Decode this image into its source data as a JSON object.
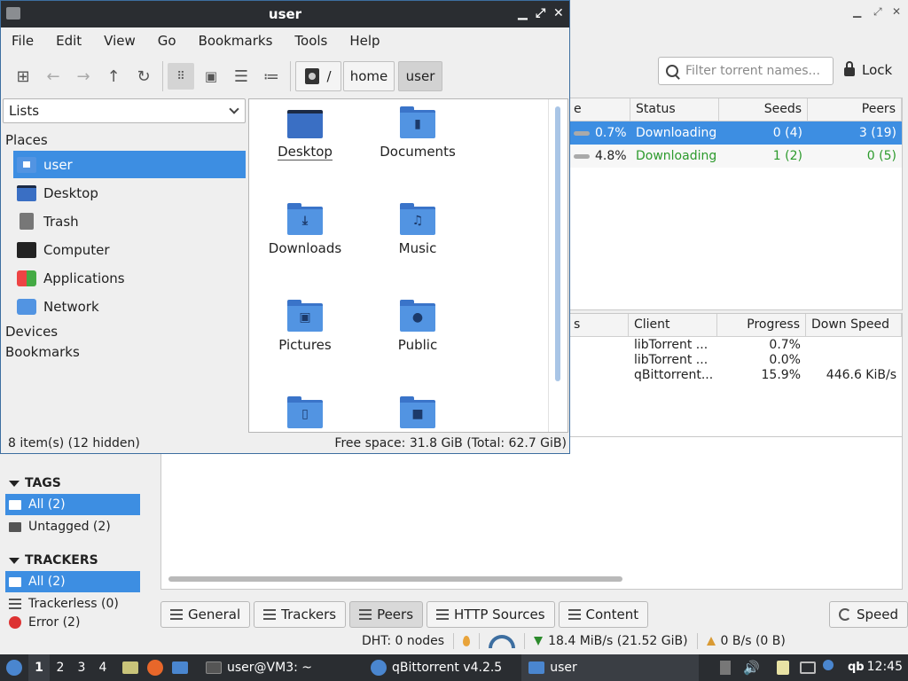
{
  "qbt": {
    "search_placeholder": "Filter torrent names...",
    "lock_label": "Lock",
    "torrents": {
      "headers": [
        "e",
        "Status",
        "Seeds",
        "Peers"
      ],
      "rows": [
        {
          "progress": "0.7%",
          "status": "Downloading",
          "seeds": "0 (4)",
          "peers": "3 (19)"
        },
        {
          "progress": "4.8%",
          "status": "Downloading",
          "seeds": "1 (2)",
          "peers": "0 (5)"
        }
      ]
    },
    "peers": {
      "headers": [
        "s",
        "Client",
        "Progress",
        "Down Speed"
      ],
      "rows": [
        {
          "client": "libTorrent ...",
          "progress": "0.7%",
          "down": ""
        },
        {
          "client": "libTorrent ...",
          "progress": "0.0%",
          "down": ""
        },
        {
          "client": "qBittorrent...",
          "progress": "15.9%",
          "down": "446.6 KiB/s"
        }
      ]
    },
    "sidebar": {
      "tags_header": "TAGS",
      "tags": [
        "All (2)",
        "Untagged (2)"
      ],
      "trackers_header": "TRACKERS",
      "trackers": [
        "All (2)",
        "Trackerless (0)",
        "Error (2)"
      ]
    },
    "tabs": [
      "General",
      "Trackers",
      "Peers",
      "HTTP Sources",
      "Content"
    ],
    "speed_label": "Speed",
    "status": {
      "dht": "DHT: 0 nodes",
      "down": "18.4 MiB/s (21.52 GiB)",
      "up": "0 B/s (0 B)"
    }
  },
  "fm": {
    "title": "user",
    "menu": [
      "File",
      "Edit",
      "View",
      "Go",
      "Bookmarks",
      "Tools",
      "Help"
    ],
    "breadcrumb": {
      "root": "/",
      "items": [
        "home",
        "user"
      ]
    },
    "side_panel_mode": "Lists",
    "places_header": "Places",
    "places": [
      {
        "label": "user",
        "icon": "home-folder-icon"
      },
      {
        "label": "Desktop",
        "icon": "desktop-icon"
      },
      {
        "label": "Trash",
        "icon": "trash-icon"
      },
      {
        "label": "Computer",
        "icon": "computer-icon"
      },
      {
        "label": "Applications",
        "icon": "applications-icon"
      },
      {
        "label": "Network",
        "icon": "network-icon"
      }
    ],
    "devices_header": "Devices",
    "bookmarks_header": "Bookmarks",
    "files": [
      {
        "name": "Desktop",
        "glyph": ""
      },
      {
        "name": "Documents",
        "glyph": "▮"
      },
      {
        "name": "Downloads",
        "glyph": "⤓"
      },
      {
        "name": "Music",
        "glyph": "♫"
      },
      {
        "name": "Pictures",
        "glyph": "▣"
      },
      {
        "name": "Public",
        "glyph": "●"
      },
      {
        "name": "",
        "glyph": "▯"
      },
      {
        "name": "",
        "glyph": "■"
      }
    ],
    "status_left": "8 item(s) (12 hidden)",
    "status_right": "Free space: 31.8 GiB (Total: 62.7 GiB)"
  },
  "taskbar": {
    "workspaces": [
      "1",
      "2",
      "3",
      "4"
    ],
    "tasks": [
      "user@VM3: ~",
      "qBittorrent v4.2.5",
      "user"
    ],
    "clock": "12:45"
  },
  "colors": {
    "accent": "#3d8ee2",
    "folder": "#5294e2",
    "downloading": "#2c9a2c"
  }
}
